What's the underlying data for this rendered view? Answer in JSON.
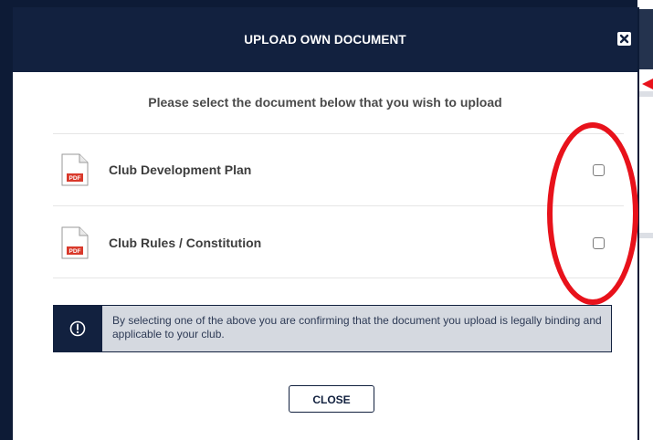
{
  "modal": {
    "title": "UPLOAD OWN DOCUMENT",
    "subtitle": "Please select the document below that you wish to upload"
  },
  "documents": [
    {
      "icon": "pdf-icon",
      "icon_text": "PDF",
      "label": "Club Development Plan",
      "checked": false
    },
    {
      "icon": "pdf-icon",
      "icon_text": "PDF",
      "label": "Club Rules / Constitution",
      "checked": false
    }
  ],
  "notice": {
    "icon": "exclamation-circle-icon",
    "text": "By selecting one of the above you are confirming that the document you upload is legally binding and applicable to your club."
  },
  "buttons": {
    "close_label": "CLOSE",
    "close_icon": "close-x-icon"
  },
  "colors": {
    "header_bg": "#12213f",
    "annotation": "#e8121b",
    "pdf_badge": "#d9392b",
    "notice_bg": "#d5d9e0"
  }
}
